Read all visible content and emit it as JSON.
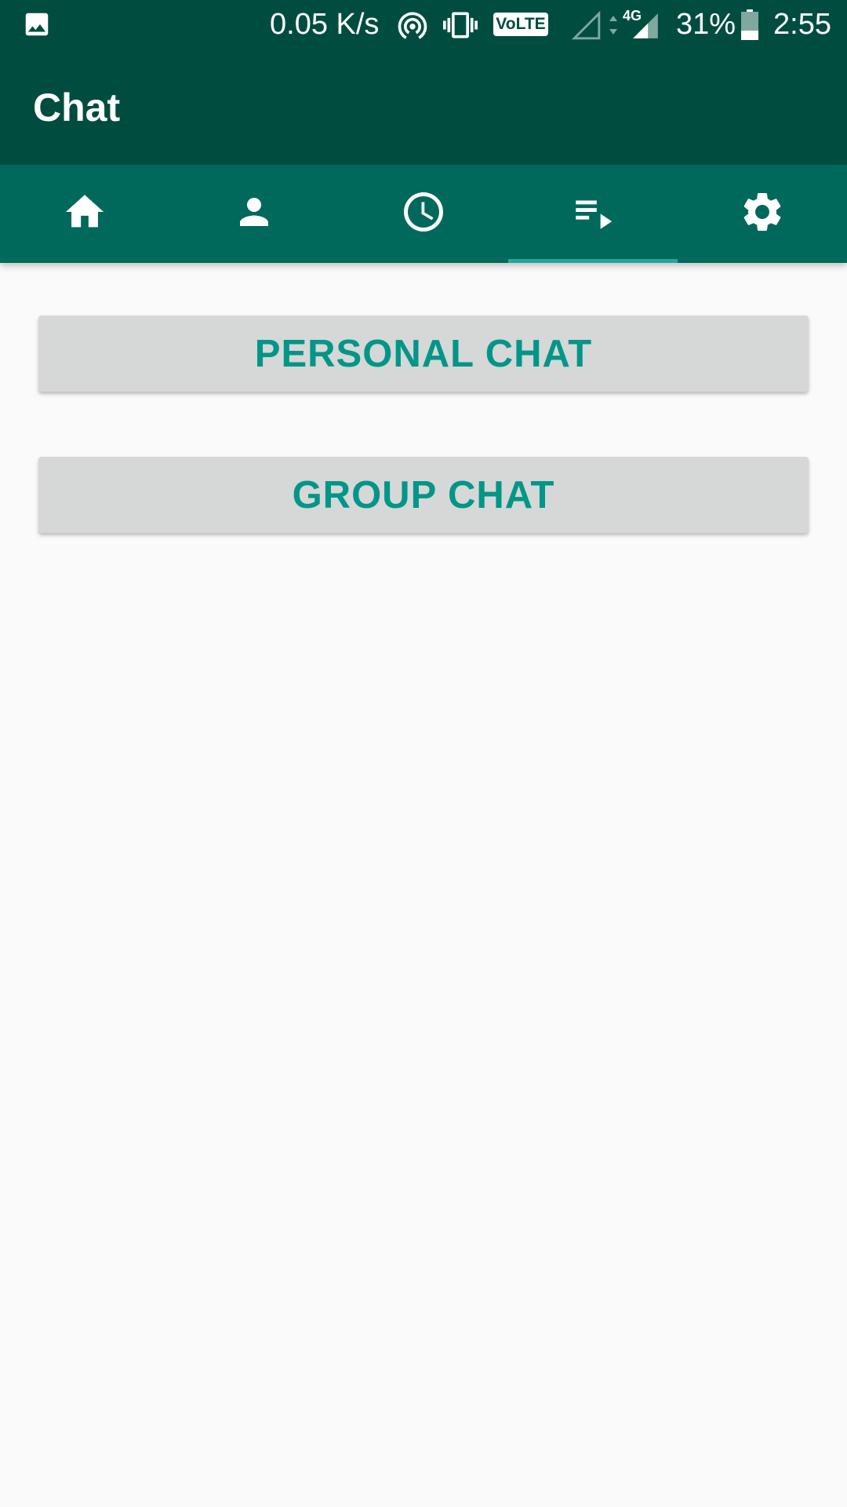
{
  "status_bar": {
    "network_speed": "0.05 K/s",
    "volte_label": "VoLTE",
    "network_type": "4G",
    "battery": "31%",
    "time": "2:55",
    "battery_level": 0.31,
    "icons": [
      "image-icon",
      "hotspot-icon",
      "vibrate-icon",
      "volte-icon",
      "signal-empty-icon",
      "data-arrows-icon",
      "signal-icon",
      "battery-icon"
    ]
  },
  "app_bar": {
    "title": "Chat"
  },
  "tabs": [
    {
      "name": "home",
      "icon": "home-icon",
      "selected": false
    },
    {
      "name": "profile",
      "icon": "person-icon",
      "selected": false
    },
    {
      "name": "history",
      "icon": "clock-icon",
      "selected": false
    },
    {
      "name": "chat",
      "icon": "playlist-icon",
      "selected": true
    },
    {
      "name": "settings",
      "icon": "gear-icon",
      "selected": false
    }
  ],
  "main": {
    "personal_chat_label": "PERSONAL CHAT",
    "group_chat_label": "GROUP CHAT"
  },
  "colors": {
    "status_bar": "#004d40",
    "app_bar": "#004d40",
    "tab_bar": "#00695c",
    "tab_indicator": "#26a69a",
    "button_bg": "#d6d7d7",
    "button_text": "#009688",
    "background": "#fafafa"
  }
}
